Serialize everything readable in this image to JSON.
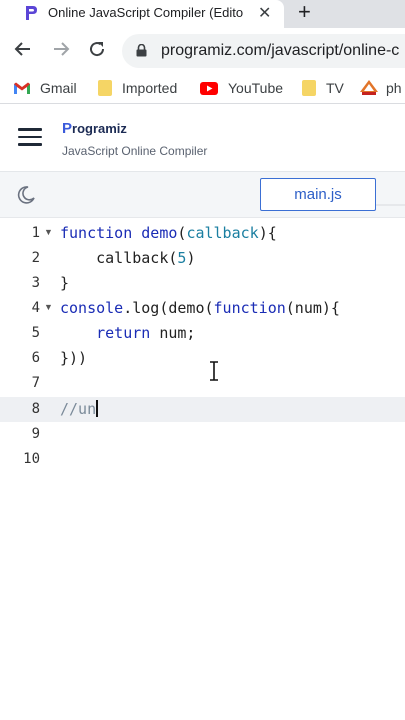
{
  "browser": {
    "tab_title": "Online JavaScript Compiler (Edito",
    "url": "programiz.com/javascript/online-c",
    "bookmarks": [
      {
        "label": "Gmail",
        "icon": "gmail-icon"
      },
      {
        "label": "Imported",
        "icon": "folder-icon"
      },
      {
        "label": "YouTube",
        "icon": "youtube-icon"
      },
      {
        "label": "TV",
        "icon": "folder-icon"
      },
      {
        "label": "ph",
        "icon": "pma-icon"
      }
    ]
  },
  "site": {
    "logo_p": "P",
    "logo_rest": "rogramiz",
    "subtitle": "JavaScript Online Compiler"
  },
  "toolbar": {
    "file_tab": "main.js"
  },
  "editor": {
    "line_numbers": [
      "1",
      "2",
      "3",
      "4",
      "5",
      "6",
      "7",
      "8",
      "9",
      "10"
    ],
    "active_line": 8,
    "lines": [
      "function demo(callback){",
      "    callback(5)",
      "}",
      "console.log(demo(function(num){",
      "    return num;",
      "}))",
      "",
      "//un",
      "",
      ""
    ]
  },
  "colors": {
    "accent": "#3b6fd4",
    "keyword": "#1a2cb5",
    "param": "#1b7fa1",
    "comment": "#7a8a99"
  }
}
